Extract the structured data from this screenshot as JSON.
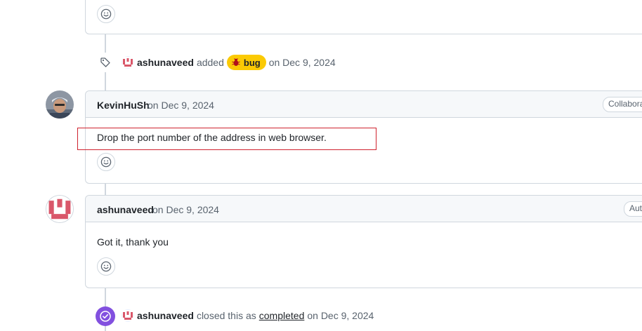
{
  "timeline": {
    "label_event": {
      "actor": "ashunaveed",
      "action": "added",
      "label": "bug",
      "date": "on Dec 9, 2024"
    },
    "comments": [
      {
        "author": "KevinHuSh",
        "date": "on Dec 9, 2024",
        "role": "Collaborator",
        "body": "Drop the port number of the address in web browser."
      },
      {
        "author": "ashunaveed",
        "date": "on Dec 9, 2024",
        "role": "Author",
        "body": "Got it, thank you"
      }
    ],
    "close_event": {
      "actor": "ashunaveed",
      "action": "closed this as",
      "state": "completed",
      "date": "on Dec 9, 2024"
    }
  },
  "colors": {
    "bug_label": "#fbca04",
    "closed_purple": "#8250df",
    "highlight_red": "#cf222e",
    "border": "#d0d7de"
  },
  "icons": {
    "emoji": "smiley-icon",
    "tag": "tag-icon",
    "closed": "check-circle-icon",
    "bug": "bug-icon"
  }
}
